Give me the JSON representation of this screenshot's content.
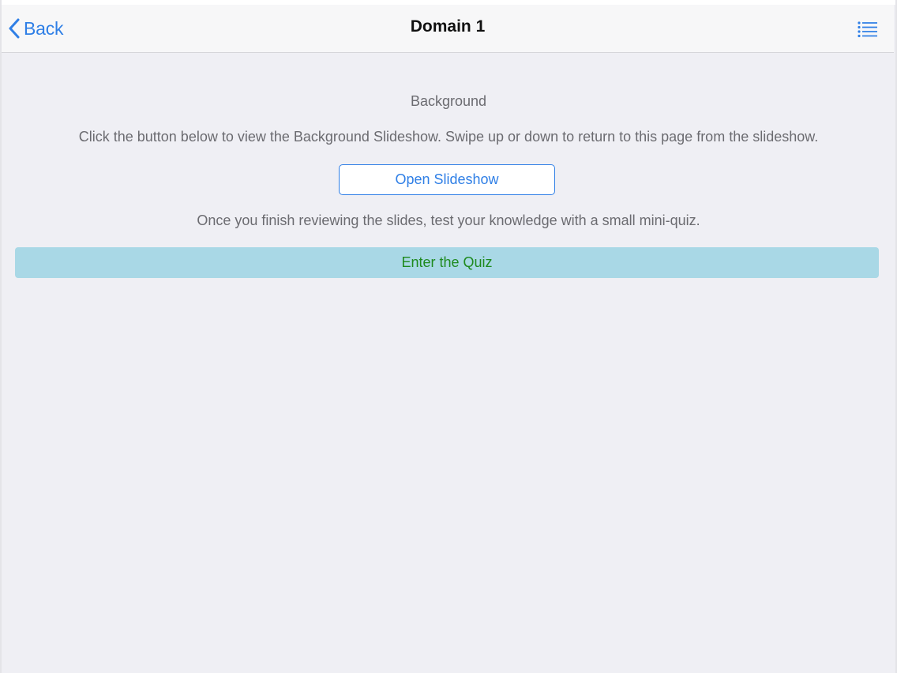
{
  "nav": {
    "back_label": "Back",
    "title": "Domain 1",
    "menu_icon": "list-icon"
  },
  "main": {
    "section_title": "Background",
    "instructions": "Click the button below to view the Background Slideshow. Swipe up or down to return to this page from the slideshow.",
    "open_button_label": "Open Slideshow",
    "quiz_note": "Once you finish reviewing the slides, test your knowledge with a small mini-quiz.",
    "quiz_button_label": "Enter the Quiz"
  },
  "colors": {
    "accent": "#2f7fe6",
    "background": "#efeff4",
    "navbar": "#f7f7f8",
    "quiz_button_bg": "#a9d8e6",
    "quiz_button_text": "#1e8a1e",
    "body_text": "#6b6b70"
  }
}
